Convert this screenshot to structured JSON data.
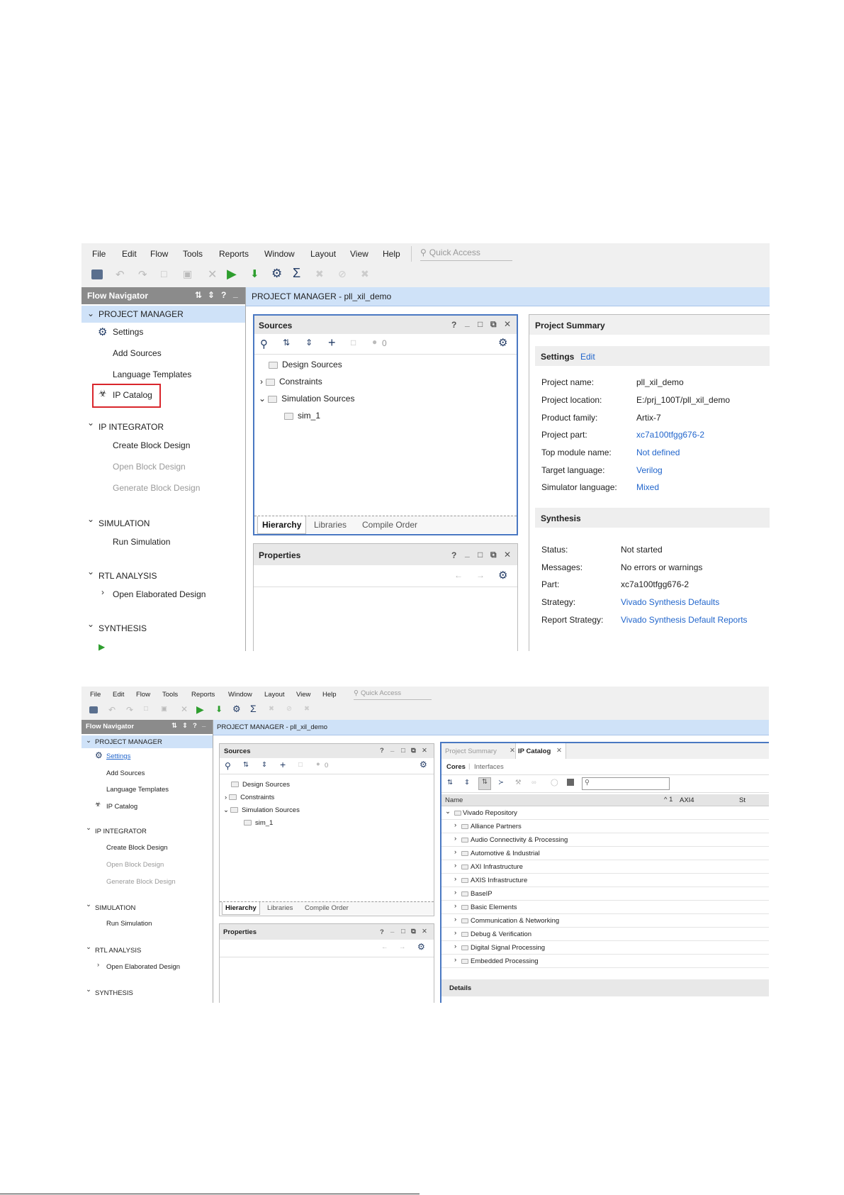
{
  "menu": [
    "File",
    "Edit",
    "Flow",
    "Tools",
    "Reports",
    "Window",
    "Layout",
    "View",
    "Help"
  ],
  "quick_access_placeholder": "Quick Access",
  "flow_navigator": {
    "title": "Flow Navigator",
    "project_manager": "PROJECT MANAGER",
    "settings": "Settings",
    "add_sources": "Add Sources",
    "language_templates": "Language Templates",
    "ip_catalog": "IP Catalog",
    "ip_integrator": "IP INTEGRATOR",
    "create_block_design": "Create Block Design",
    "open_block_design": "Open Block Design",
    "generate_block_design": "Generate Block Design",
    "simulation": "SIMULATION",
    "run_simulation": "Run Simulation",
    "rtl_analysis": "RTL ANALYSIS",
    "open_elaborated_design": "Open Elaborated Design",
    "synthesis": "SYNTHESIS"
  },
  "project_manager_header": "PROJECT MANAGER - pll_xil_demo",
  "sources": {
    "title": "Sources",
    "count": "0",
    "tree": [
      "Design Sources",
      "Constraints",
      "Simulation Sources",
      "sim_1"
    ],
    "tabs": [
      "Hierarchy",
      "Libraries",
      "Compile Order"
    ]
  },
  "properties": {
    "title": "Properties"
  },
  "summary": {
    "title": "Project Summary",
    "settings_label": "Settings",
    "edit_label": "Edit",
    "rows": [
      {
        "k": "Project name:",
        "v": "pll_xil_demo"
      },
      {
        "k": "Project location:",
        "v": "E:/prj_100T/pll_xil_demo"
      },
      {
        "k": "Product family:",
        "v": "Artix-7"
      },
      {
        "k": "Project part:",
        "v": "xc7a100tfgg676-2"
      },
      {
        "k": "Top module name:",
        "v": "Not defined"
      },
      {
        "k": "Target language:",
        "v": "Verilog"
      },
      {
        "k": "Simulator language:",
        "v": "Mixed"
      }
    ],
    "synthesis_label": "Synthesis",
    "synth_rows": [
      {
        "k": "Status:",
        "v": "Not started"
      },
      {
        "k": "Messages:",
        "v": "No errors or warnings"
      },
      {
        "k": "Part:",
        "v": "xc7a100tfgg676-2"
      },
      {
        "k": "Strategy:",
        "v": "Vivado Synthesis Defaults"
      },
      {
        "k": "Report Strategy:",
        "v": "Vivado Synthesis Default Reports"
      }
    ]
  },
  "ip_catalog": {
    "tab_summary": "Project Summary",
    "tab_catalog": "IP Catalog",
    "subtab_cores": "Cores",
    "subtab_interfaces": "Interfaces",
    "col_name": "Name",
    "col_sort": "^ 1",
    "col_axi4": "AXI4",
    "col_status": "St",
    "repository": "Vivado Repository",
    "categories": [
      "Alliance Partners",
      "Audio Connectivity & Processing",
      "Automotive & Industrial",
      "AXI Infrastructure",
      "AXIS Infrastructure",
      "BaseIP",
      "Basic Elements",
      "Communication & Networking",
      "Debug & Verification",
      "Digital Signal Processing",
      "Embedded Processing"
    ],
    "details": "Details"
  },
  "colors": {
    "accent": "#2266cc",
    "highlight": "#d9262c",
    "selected_bg": "#cfe2f8",
    "run_green": "#2e9e2e"
  }
}
